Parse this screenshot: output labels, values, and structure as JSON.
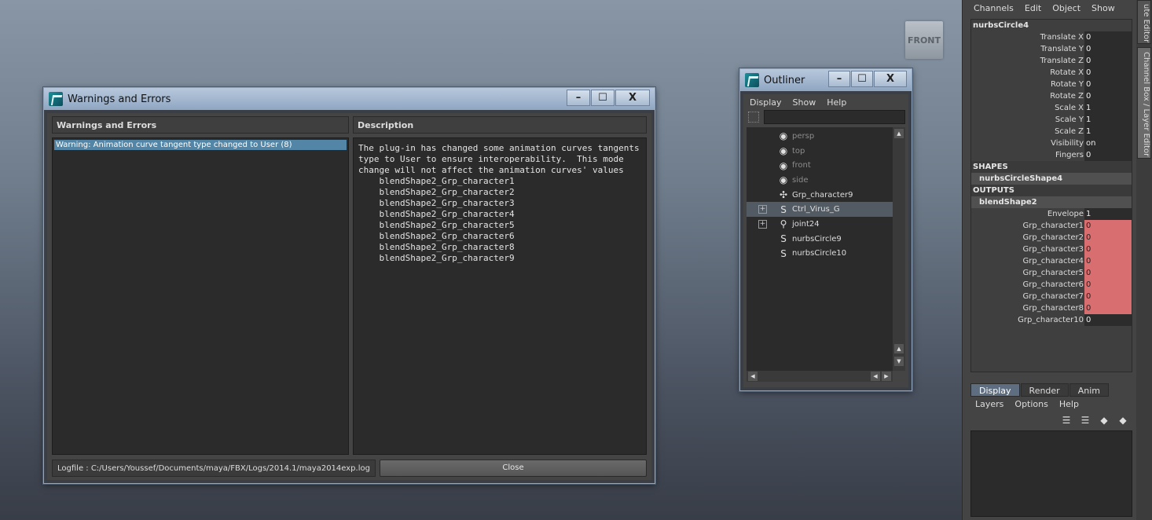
{
  "viewport": {
    "cube_label": "FRONT"
  },
  "warnings_window": {
    "title": "Warnings and Errors",
    "list_header": "Warnings and Errors",
    "description_header": "Description",
    "items": [
      "Warning: Animation curve tangent type changed to User (8)"
    ],
    "description_lines": [
      "The plug-in has changed some animation curves tangents",
      "type to User to ensure interoperability.  This mode",
      "change will not affect the animation curves' values",
      "    blendShape2_Grp_character1",
      "    blendShape2_Grp_character2",
      "    blendShape2_Grp_character3",
      "    blendShape2_Grp_character4",
      "    blendShape2_Grp_character5",
      "    blendShape2_Grp_character6",
      "    blendShape2_Grp_character8",
      "    blendShape2_Grp_character9"
    ],
    "logfile": "Logfile : C:/Users/Youssef/Documents/maya/FBX/Logs/2014.1/maya2014exp.log",
    "close_label": "Close",
    "btn_min": "–",
    "btn_max": "☐",
    "btn_close": "X"
  },
  "outliner": {
    "title": "Outliner",
    "menus": [
      "Display",
      "Show",
      "Help"
    ],
    "items": [
      {
        "label": "persp",
        "icon": "camera-icon",
        "dim": true,
        "expander": false,
        "selected": false
      },
      {
        "label": "top",
        "icon": "camera-icon",
        "dim": true,
        "expander": false,
        "selected": false
      },
      {
        "label": "front",
        "icon": "camera-icon",
        "dim": true,
        "expander": false,
        "selected": false
      },
      {
        "label": "side",
        "icon": "camera-icon",
        "dim": true,
        "expander": false,
        "selected": false
      },
      {
        "label": "Grp_character9",
        "icon": "group-icon",
        "dim": false,
        "expander": false,
        "selected": false
      },
      {
        "label": "Ctrl_Virus_G",
        "icon": "curve-icon",
        "dim": false,
        "expander": true,
        "selected": true
      },
      {
        "label": "joint24",
        "icon": "joint-icon",
        "dim": false,
        "expander": true,
        "selected": false
      },
      {
        "label": "nurbsCircle9",
        "icon": "curve-icon",
        "dim": false,
        "expander": false,
        "selected": false
      },
      {
        "label": "nurbsCircle10",
        "icon": "curve-icon",
        "dim": false,
        "expander": false,
        "selected": false
      }
    ],
    "btn_min": "–",
    "btn_max": "☐",
    "btn_close": "X"
  },
  "channel_box": {
    "menus": [
      "Channels",
      "Edit",
      "Object",
      "Show"
    ],
    "node": "nurbsCircle4",
    "attributes": [
      {
        "name": "Translate X",
        "value": "0"
      },
      {
        "name": "Translate Y",
        "value": "0"
      },
      {
        "name": "Translate Z",
        "value": "0"
      },
      {
        "name": "Rotate X",
        "value": "0"
      },
      {
        "name": "Rotate Y",
        "value": "0"
      },
      {
        "name": "Rotate Z",
        "value": "0"
      },
      {
        "name": "Scale X",
        "value": "1"
      },
      {
        "name": "Scale Y",
        "value": "1"
      },
      {
        "name": "Scale Z",
        "value": "1"
      },
      {
        "name": "Visibility",
        "value": "on"
      },
      {
        "name": "Fingers",
        "value": "0"
      }
    ],
    "shapes_label": "SHAPES",
    "shape_node": "nurbsCircleShape4",
    "outputs_label": "OUTPUTS",
    "output_node": "blendShape2",
    "output_attributes": [
      {
        "name": "Envelope",
        "value": "1",
        "keyed": false
      },
      {
        "name": "Grp_character1",
        "value": "0",
        "keyed": true
      },
      {
        "name": "Grp_character2",
        "value": "0",
        "keyed": true
      },
      {
        "name": "Grp_character3",
        "value": "0",
        "keyed": true
      },
      {
        "name": "Grp_character4",
        "value": "0",
        "keyed": true
      },
      {
        "name": "Grp_character5",
        "value": "0",
        "keyed": true
      },
      {
        "name": "Grp_character6",
        "value": "0",
        "keyed": true
      },
      {
        "name": "Grp_character7",
        "value": "0",
        "keyed": true
      },
      {
        "name": "Grp_character8",
        "value": "0",
        "keyed": true
      },
      {
        "name": "Grp_character10",
        "value": "0",
        "keyed": false
      }
    ],
    "keyed_color": "#d86e70",
    "side_tabs": [
      "ute Editor",
      "Channel Box / Layer Editor"
    ]
  },
  "layer_editor": {
    "tabs": [
      "Display",
      "Render",
      "Anim"
    ],
    "active_tab": "Display",
    "menus": [
      "Layers",
      "Options",
      "Help"
    ]
  }
}
